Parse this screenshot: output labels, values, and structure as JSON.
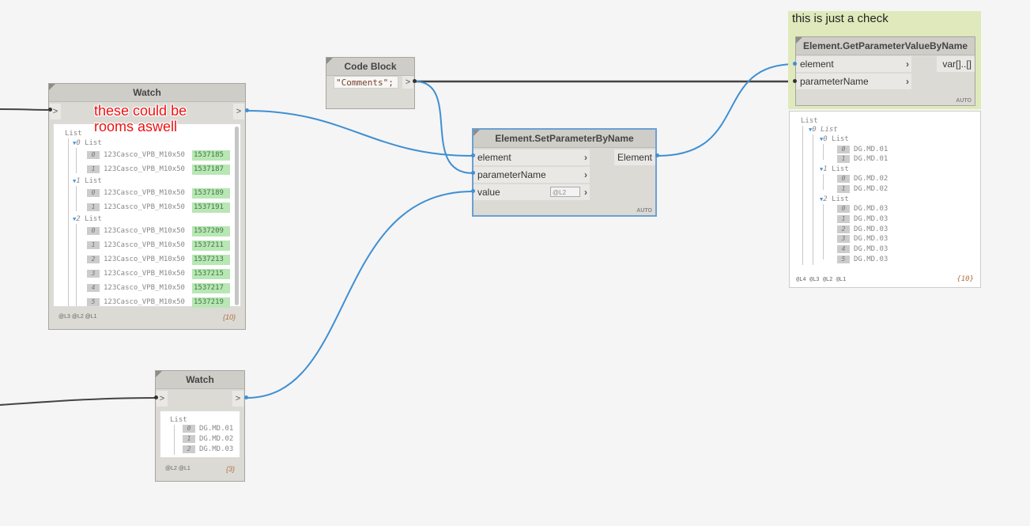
{
  "group": {
    "title": "this is just a check"
  },
  "code_block": {
    "title": "Code Block",
    "code": "\"Comments\";",
    "out_port": ">"
  },
  "watch1": {
    "title": "Watch",
    "in_port": ">",
    "out_port": ">",
    "note_line1": "these could be",
    "note_line2": "rooms aswell",
    "root_label": "List",
    "groups": [
      {
        "label": "0 List",
        "items": [
          {
            "index": "0",
            "name": "123Casco_VPB_M10x50",
            "id": "1537185"
          },
          {
            "index": "1",
            "name": "123Casco_VPB_M10x50",
            "id": "1537187"
          }
        ]
      },
      {
        "label": "1 List",
        "items": [
          {
            "index": "0",
            "name": "123Casco_VPB_M10x50",
            "id": "1537189"
          },
          {
            "index": "1",
            "name": "123Casco_VPB_M10x50",
            "id": "1537191"
          }
        ]
      },
      {
        "label": "2 List",
        "items": [
          {
            "index": "0",
            "name": "123Casco_VPB_M10x50",
            "id": "1537209"
          },
          {
            "index": "1",
            "name": "123Casco_VPB_M10x50",
            "id": "1537211"
          },
          {
            "index": "2",
            "name": "123Casco_VPB_M10x50",
            "id": "1537213"
          },
          {
            "index": "3",
            "name": "123Casco_VPB_M10x50",
            "id": "1537215"
          },
          {
            "index": "4",
            "name": "123Casco_VPB_M10x50",
            "id": "1537217"
          },
          {
            "index": "5",
            "name": "123Casco_VPB_M10x50",
            "id": "1537219"
          }
        ]
      }
    ],
    "levels": "@L3 @L2 @L1",
    "count": "{10}"
  },
  "watch2": {
    "title": "Watch",
    "in_port": ">",
    "out_port": ">",
    "root_label": "List",
    "items": [
      {
        "index": "0",
        "value": "DG.MD.01"
      },
      {
        "index": "1",
        "value": "DG.MD.02"
      },
      {
        "index": "2",
        "value": "DG.MD.03"
      }
    ],
    "levels": "@L2 @L1",
    "count": "{3}"
  },
  "set_param": {
    "title": "Element.SetParameterByName",
    "inputs": [
      "element",
      "parameterName",
      "value"
    ],
    "output": "Element",
    "lacing": "@L2",
    "auto": "AUTO"
  },
  "get_param": {
    "title": "Element.GetParameterValueByName",
    "inputs": [
      "element",
      "parameterName"
    ],
    "output": "var[]..[]",
    "auto": "AUTO",
    "preview": {
      "root_label": "List",
      "outer_label": "0 List",
      "groups": [
        {
          "label": "0 List",
          "items": [
            {
              "index": "0",
              "value": "DG.MD.01"
            },
            {
              "index": "1",
              "value": "DG.MD.01"
            }
          ]
        },
        {
          "label": "1 List",
          "items": [
            {
              "index": "0",
              "value": "DG.MD.02"
            },
            {
              "index": "1",
              "value": "DG.MD.02"
            }
          ]
        },
        {
          "label": "2 List",
          "items": [
            {
              "index": "0",
              "value": "DG.MD.03"
            },
            {
              "index": "1",
              "value": "DG.MD.03"
            },
            {
              "index": "2",
              "value": "DG.MD.03"
            },
            {
              "index": "3",
              "value": "DG.MD.03"
            },
            {
              "index": "4",
              "value": "DG.MD.03"
            },
            {
              "index": "5",
              "value": "DG.MD.03"
            }
          ]
        }
      ],
      "levels": "@L4 @L3 @L2 @L1",
      "count": "{10}"
    }
  },
  "colors": {
    "wire_selected": "#3f8fd2",
    "wire_default": "#444444",
    "group_bg": "#dfe9bb",
    "annotation": "#ee1111"
  }
}
